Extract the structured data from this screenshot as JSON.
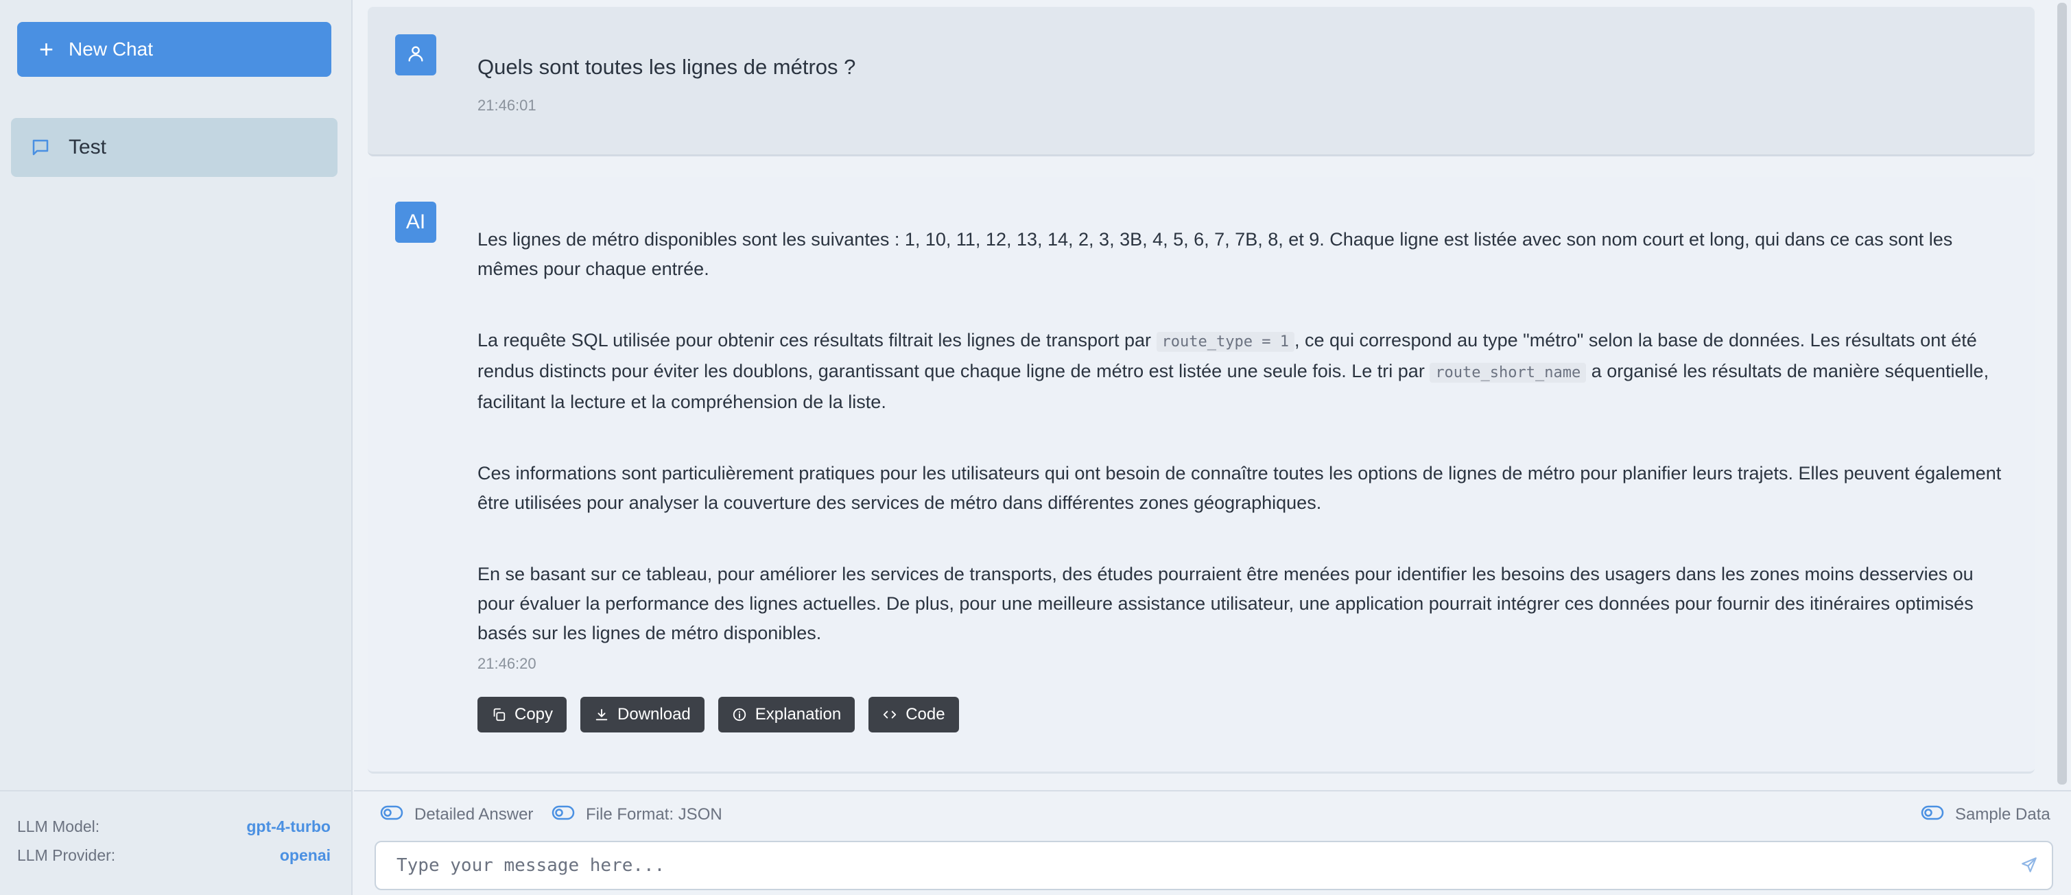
{
  "sidebar": {
    "new_chat_label": "New Chat",
    "chats": [
      {
        "label": "Test"
      }
    ],
    "footer": {
      "model_label": "LLM Model:",
      "model_value": "gpt-4-turbo",
      "provider_label": "LLM Provider:",
      "provider_value": "openai"
    }
  },
  "conversation": {
    "user_message": {
      "text": "Quels sont toutes les lignes de métros ?",
      "time": "21:46:01",
      "avatar_icon": "user-icon"
    },
    "ai_message": {
      "avatar_label": "AI",
      "paragraphs": {
        "p1": "Les lignes de métro disponibles sont les suivantes : 1, 10, 11, 12, 13, 14, 2, 3, 3B, 4, 5, 6, 7, 7B, 8, et 9. Chaque ligne est listée avec son nom court et long, qui dans ce cas sont les mêmes pour chaque entrée.",
        "p2_a": "La requête SQL utilisée pour obtenir ces résultats filtrait les lignes de transport par ",
        "p2_code1": "route_type = 1",
        "p2_b": ", ce qui correspond au type \"métro\" selon la base de données. Les résultats ont été rendus distincts pour éviter les doublons, garantissant que chaque ligne de métro est listée une seule fois. Le tri par ",
        "p2_code2": "route_short_name",
        "p2_c": " a organisé les résultats de manière séquentielle, facilitant la lecture et la compréhension de la liste.",
        "p3": "Ces informations sont particulièrement pratiques pour les utilisateurs qui ont besoin de connaître toutes les options de lignes de métro pour planifier leurs trajets. Elles peuvent également être utilisées pour analyser la couverture des services de métro dans différentes zones géographiques.",
        "p4": "En se basant sur ce tableau, pour améliorer les services de transports, des études pourraient être menées pour identifier les besoins des usagers dans les zones moins desservies ou pour évaluer la performance des lignes actuelles. De plus, pour une meilleure assistance utilisateur, une application pourrait intégrer ces données pour fournir des itinéraires optimisés basés sur les lignes de métro disponibles."
      },
      "time": "21:46:20",
      "actions": {
        "copy": "Copy",
        "download": "Download",
        "explanation": "Explanation",
        "code": "Code"
      }
    }
  },
  "bottom": {
    "toggles": {
      "detailed": "Detailed Answer",
      "format": "File Format: JSON",
      "sample": "Sample Data"
    },
    "input_placeholder": "Type your message here..."
  },
  "colors": {
    "accent": "#4a90e2",
    "sidebar_bg": "#e5ebf1",
    "selected_chat_bg": "#c3d6e1",
    "action_button_bg": "#3d4148"
  }
}
